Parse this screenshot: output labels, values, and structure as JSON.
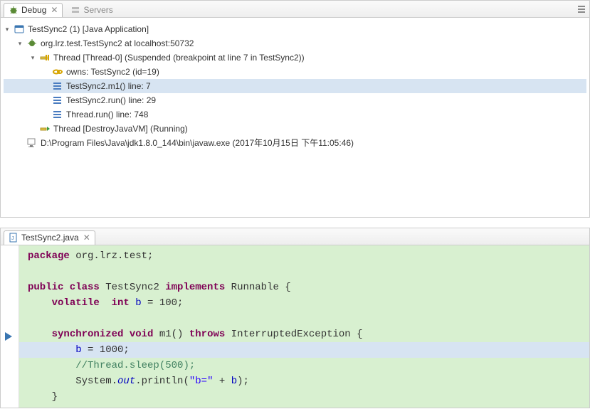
{
  "debugView": {
    "tabs": [
      {
        "label": "Debug",
        "active": true
      },
      {
        "label": "Servers",
        "active": false
      }
    ],
    "tree": {
      "app": "TestSync2 (1) [Java Application]",
      "target": "org.lrz.test.TestSync2 at localhost:50732",
      "thread0": "Thread [Thread-0] (Suspended (breakpoint at line 7 in TestSync2))",
      "owns": "owns: TestSync2  (id=19)",
      "frame1": "TestSync2.m1() line: 7",
      "frame2": "TestSync2.run() line: 29",
      "frame3": "Thread.run() line: 748",
      "thread1": "Thread [DestroyJavaVM] (Running)",
      "process": "D:\\Program Files\\Java\\jdk1.8.0_144\\bin\\javaw.exe (2017年10月15日 下午11:05:46)"
    }
  },
  "editorView": {
    "tabs": [
      {
        "label": "TestSync2.java",
        "active": true
      }
    ],
    "code": {
      "l1_kw": "package",
      "l1_rest": " org.lrz.test;",
      "l2": "",
      "l3_a": "public class",
      "l3_b": " TestSync2 ",
      "l3_c": "implements",
      "l3_d": " Runnable {",
      "l4_a": "    ",
      "l4_b": "volatile  int",
      "l4_c": " b",
      "l4_d": " = 100;",
      "l5": "",
      "l6_a": "    ",
      "l6_b": "synchronized void",
      "l6_c": " m1() ",
      "l6_d": "throws",
      "l6_e": " InterruptedException {",
      "l7_a": "        ",
      "l7_b": "b",
      "l7_c": " = 1000;",
      "l8_a": "        ",
      "l8_b": "//Thread.sleep(500);",
      "l9_a": "        System.",
      "l9_b": "out",
      "l9_c": ".println(",
      "l9_d": "\"b=\"",
      "l9_e": " + ",
      "l9_f": "b",
      "l9_g": ");",
      "l10": "    }"
    }
  }
}
